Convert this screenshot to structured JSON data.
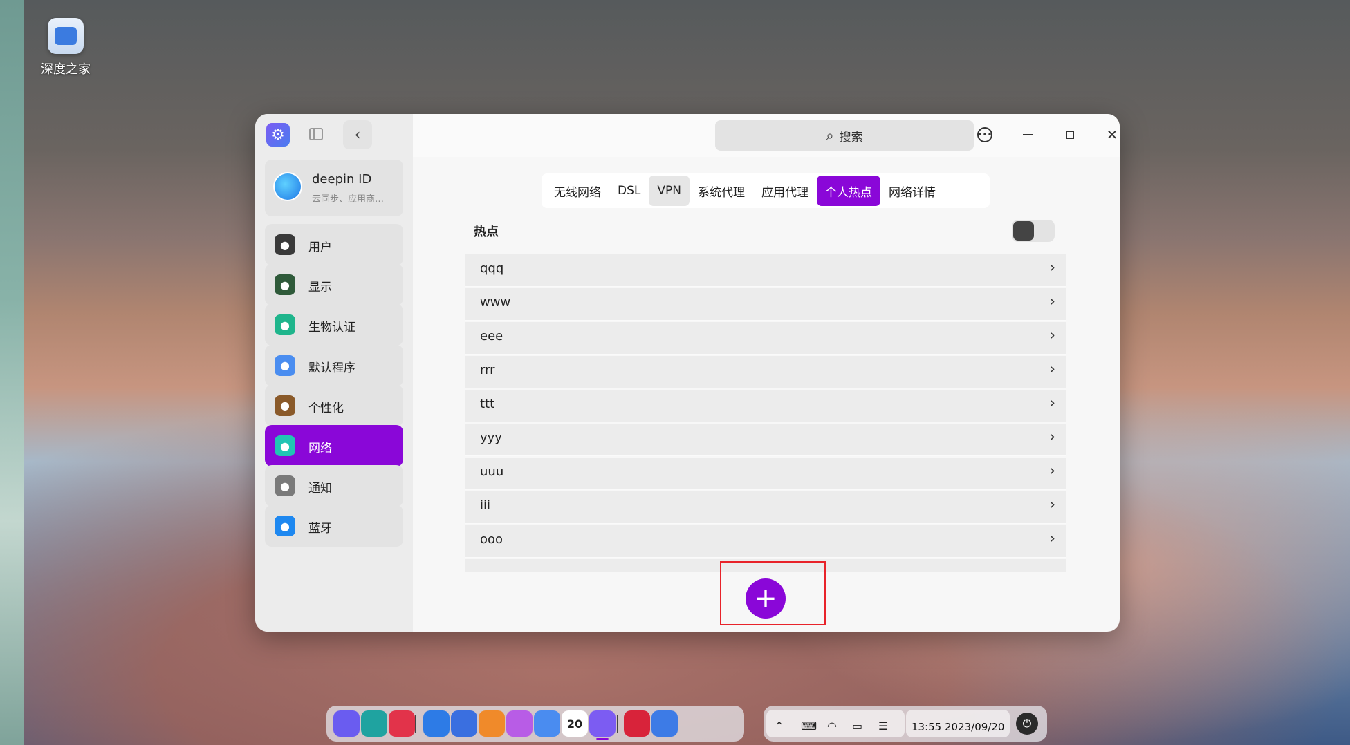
{
  "desktop": {
    "icon_label": "深度之家"
  },
  "window": {
    "search_placeholder": "搜索",
    "account": {
      "name": "deepin ID",
      "sub": "云同步、应用商…"
    },
    "nav": [
      {
        "label": "用户",
        "icon": "user-icon",
        "color": "#3a3a3a"
      },
      {
        "label": "显示",
        "icon": "display-icon",
        "color": "#2f5a3a"
      },
      {
        "label": "生物认证",
        "icon": "fingerprint-icon",
        "color": "#1fb58c"
      },
      {
        "label": "默认程序",
        "icon": "default-apps-icon",
        "color": "#4a8df0"
      },
      {
        "label": "个性化",
        "icon": "personalization-icon",
        "color": "#8a5a2a"
      },
      {
        "label": "网络",
        "icon": "network-icon",
        "color": "#21c4b4"
      },
      {
        "label": "通知",
        "icon": "bell-icon",
        "color": "#7a7a7a"
      },
      {
        "label": "蓝牙",
        "icon": "bluetooth-icon",
        "color": "#1e88f0"
      }
    ],
    "active_nav": "网络",
    "tabs": [
      "无线网络",
      "DSL",
      "VPN",
      "系统代理",
      "应用代理",
      "个人热点",
      "网络详情"
    ],
    "active_tab": "个人热点",
    "hotspot_title": "热点",
    "hotspot_enabled": false,
    "hotspots": [
      "qqq",
      "www",
      "eee",
      "rrr",
      "ttt",
      "yyy",
      "uuu",
      "iii",
      "ooo"
    ],
    "add_button_symbol": "+",
    "accent_color": "#8a07d8"
  },
  "taskbar": {
    "apps": [
      "launcher-icon",
      "file-manager-icon",
      "app-store-icon",
      "text-editor-icon",
      "browser-icon",
      "draw-icon",
      "photos-icon",
      "music-icon",
      "calendar-icon",
      "control-center-icon",
      "terminal-icon",
      "downloader-icon"
    ],
    "calendar_day": "20",
    "time": "13:55",
    "date": "2023/09/20"
  }
}
